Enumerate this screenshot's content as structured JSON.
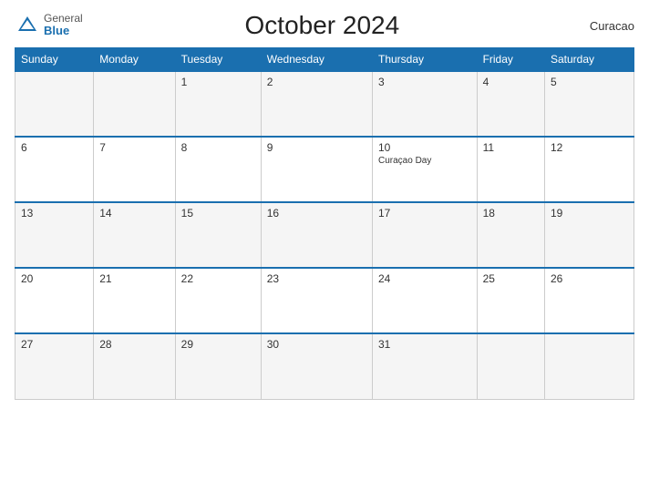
{
  "header": {
    "logo_general": "General",
    "logo_blue": "Blue",
    "title": "October 2024",
    "region": "Curacao"
  },
  "days_of_week": [
    "Sunday",
    "Monday",
    "Tuesday",
    "Wednesday",
    "Thursday",
    "Friday",
    "Saturday"
  ],
  "weeks": [
    [
      {
        "day": "",
        "event": ""
      },
      {
        "day": "",
        "event": ""
      },
      {
        "day": "1",
        "event": ""
      },
      {
        "day": "2",
        "event": ""
      },
      {
        "day": "3",
        "event": ""
      },
      {
        "day": "4",
        "event": ""
      },
      {
        "day": "5",
        "event": ""
      }
    ],
    [
      {
        "day": "6",
        "event": ""
      },
      {
        "day": "7",
        "event": ""
      },
      {
        "day": "8",
        "event": ""
      },
      {
        "day": "9",
        "event": ""
      },
      {
        "day": "10",
        "event": "Curaçao Day"
      },
      {
        "day": "11",
        "event": ""
      },
      {
        "day": "12",
        "event": ""
      }
    ],
    [
      {
        "day": "13",
        "event": ""
      },
      {
        "day": "14",
        "event": ""
      },
      {
        "day": "15",
        "event": ""
      },
      {
        "day": "16",
        "event": ""
      },
      {
        "day": "17",
        "event": ""
      },
      {
        "day": "18",
        "event": ""
      },
      {
        "day": "19",
        "event": ""
      }
    ],
    [
      {
        "day": "20",
        "event": ""
      },
      {
        "day": "21",
        "event": ""
      },
      {
        "day": "22",
        "event": ""
      },
      {
        "day": "23",
        "event": ""
      },
      {
        "day": "24",
        "event": ""
      },
      {
        "day": "25",
        "event": ""
      },
      {
        "day": "26",
        "event": ""
      }
    ],
    [
      {
        "day": "27",
        "event": ""
      },
      {
        "day": "28",
        "event": ""
      },
      {
        "day": "29",
        "event": ""
      },
      {
        "day": "30",
        "event": ""
      },
      {
        "day": "31",
        "event": ""
      },
      {
        "day": "",
        "event": ""
      },
      {
        "day": "",
        "event": ""
      }
    ]
  ]
}
